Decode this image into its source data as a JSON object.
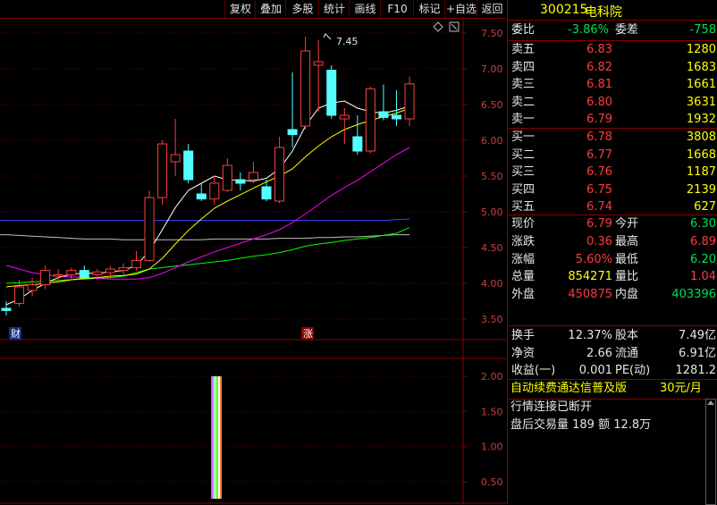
{
  "toolbar": {
    "buttons": [
      "复权",
      "叠加",
      "多股",
      "统计",
      "画线",
      "F10",
      "标记",
      "+自选",
      "返回"
    ]
  },
  "chart": {
    "price_ticks": [
      "7.50",
      "7.00",
      "6.50",
      "6.00",
      "5.50",
      "5.00",
      "4.50",
      "4.00",
      "3.50"
    ],
    "volume_ticks": [
      "2.00",
      "1.50",
      "1.00",
      "0.50"
    ],
    "high_label": "7.45",
    "marker_cai": "财",
    "marker_zhang": "涨"
  },
  "chart_data": {
    "type": "candlestick",
    "ylim": [
      3.3,
      7.7
    ],
    "candles": [
      {
        "o": 3.65,
        "h": 3.75,
        "l": 3.55,
        "c": 3.62
      },
      {
        "o": 3.72,
        "h": 4.05,
        "l": 3.68,
        "c": 3.95
      },
      {
        "o": 3.9,
        "h": 4.08,
        "l": 3.82,
        "c": 3.98
      },
      {
        "o": 3.98,
        "h": 4.25,
        "l": 3.92,
        "c": 4.18
      },
      {
        "o": 4.1,
        "h": 4.2,
        "l": 4.02,
        "c": 4.12
      },
      {
        "o": 4.12,
        "h": 4.22,
        "l": 4.05,
        "c": 4.18
      },
      {
        "o": 4.18,
        "h": 4.25,
        "l": 4.1,
        "c": 4.08
      },
      {
        "o": 4.12,
        "h": 4.2,
        "l": 4.05,
        "c": 4.16
      },
      {
        "o": 4.15,
        "h": 4.24,
        "l": 4.1,
        "c": 4.2
      },
      {
        "o": 4.18,
        "h": 4.28,
        "l": 4.12,
        "c": 4.22
      },
      {
        "o": 4.22,
        "h": 4.45,
        "l": 4.18,
        "c": 4.32
      },
      {
        "o": 4.32,
        "h": 5.3,
        "l": 4.3,
        "c": 5.2
      },
      {
        "o": 5.2,
        "h": 6.0,
        "l": 5.1,
        "c": 5.95
      },
      {
        "o": 5.7,
        "h": 6.3,
        "l": 5.5,
        "c": 5.8
      },
      {
        "o": 5.85,
        "h": 5.95,
        "l": 5.4,
        "c": 5.45
      },
      {
        "o": 5.25,
        "h": 5.4,
        "l": 5.15,
        "c": 5.18
      },
      {
        "o": 5.18,
        "h": 5.5,
        "l": 5.1,
        "c": 5.4
      },
      {
        "o": 5.3,
        "h": 5.75,
        "l": 5.28,
        "c": 5.65
      },
      {
        "o": 5.45,
        "h": 5.55,
        "l": 5.3,
        "c": 5.4
      },
      {
        "o": 5.45,
        "h": 5.7,
        "l": 5.4,
        "c": 5.55
      },
      {
        "o": 5.35,
        "h": 5.45,
        "l": 5.15,
        "c": 5.18
      },
      {
        "o": 5.15,
        "h": 6.05,
        "l": 5.12,
        "c": 5.9
      },
      {
        "o": 6.15,
        "h": 6.95,
        "l": 5.9,
        "c": 6.08
      },
      {
        "o": 6.2,
        "h": 7.45,
        "l": 6.15,
        "c": 7.25
      },
      {
        "o": 7.05,
        "h": 7.4,
        "l": 6.4,
        "c": 7.1
      },
      {
        "o": 6.98,
        "h": 7.05,
        "l": 6.3,
        "c": 6.35
      },
      {
        "o": 6.3,
        "h": 6.45,
        "l": 5.95,
        "c": 6.35
      },
      {
        "o": 6.05,
        "h": 6.35,
        "l": 5.8,
        "c": 5.85
      },
      {
        "o": 5.85,
        "h": 6.75,
        "l": 5.82,
        "c": 6.72
      },
      {
        "o": 6.4,
        "h": 6.78,
        "l": 6.28,
        "c": 6.32
      },
      {
        "o": 6.35,
        "h": 6.7,
        "l": 6.2,
        "c": 6.3
      },
      {
        "o": 6.3,
        "h": 6.89,
        "l": 6.2,
        "c": 6.79
      }
    ],
    "ma5": [
      3.7,
      3.78,
      3.9,
      4.0,
      4.08,
      4.13,
      4.14,
      4.14,
      4.16,
      4.18,
      4.25,
      4.45,
      4.75,
      5.06,
      5.3,
      5.4,
      5.5,
      5.45,
      5.44,
      5.43,
      5.47,
      5.6,
      5.85,
      6.2,
      6.45,
      6.52,
      6.55,
      6.45,
      6.4,
      6.38,
      6.42,
      6.48
    ],
    "ma10": [
      3.95,
      3.97,
      3.98,
      4.0,
      4.02,
      4.05,
      4.07,
      4.08,
      4.1,
      4.11,
      4.13,
      4.2,
      4.35,
      4.55,
      4.74,
      4.9,
      5.05,
      5.15,
      5.24,
      5.33,
      5.42,
      5.5,
      5.6,
      5.77,
      5.92,
      6.05,
      6.15,
      6.22,
      6.28,
      6.33,
      6.38,
      6.45
    ],
    "ma20": [
      4.25,
      4.2,
      4.15,
      4.12,
      4.1,
      4.09,
      4.08,
      4.07,
      4.06,
      4.06,
      4.06,
      4.08,
      4.14,
      4.22,
      4.3,
      4.37,
      4.44,
      4.5,
      4.56,
      4.62,
      4.68,
      4.75,
      4.85,
      4.97,
      5.1,
      5.23,
      5.34,
      5.44,
      5.56,
      5.68,
      5.8,
      5.9
    ],
    "ma30": [
      4.0,
      4.01,
      4.02,
      4.03,
      4.04,
      4.05,
      4.06,
      4.07,
      4.08,
      4.1,
      4.15,
      4.2,
      4.22,
      4.24,
      4.26,
      4.28,
      4.3,
      4.32,
      4.35,
      4.38,
      4.4,
      4.43,
      4.47,
      4.52,
      4.55,
      4.57,
      4.6,
      4.62,
      4.64,
      4.67,
      4.7,
      4.78
    ],
    "ma60": [
      4.88,
      4.88,
      4.88,
      4.88,
      4.88,
      4.88,
      4.88,
      4.88,
      4.88,
      4.88,
      4.88,
      4.88,
      4.88,
      4.88,
      4.88,
      4.88,
      4.88,
      4.88,
      4.88,
      4.88,
      4.88,
      4.88,
      4.88,
      4.88,
      4.88,
      4.88,
      4.88,
      4.88,
      4.88,
      4.88,
      4.89,
      4.9
    ],
    "ma120": [
      4.68,
      4.67,
      4.66,
      4.65,
      4.64,
      4.63,
      4.62,
      4.62,
      4.62,
      4.61,
      4.61,
      4.61,
      4.61,
      4.61,
      4.61,
      4.61,
      4.62,
      4.62,
      4.62,
      4.62,
      4.62,
      4.63,
      4.63,
      4.63,
      4.64,
      4.64,
      4.65,
      4.65,
      4.66,
      4.67,
      4.68,
      4.68
    ],
    "volume": {
      "ylim": [
        0,
        2.2
      ],
      "bar_index": 10,
      "value": 2.0
    },
    "colors": {
      "up": "#ff3c3c",
      "down": "#54ffff",
      "ma5": "#ffffff",
      "ma10": "#ffff00",
      "ma20": "#ff00ff",
      "ma30": "#00ff00",
      "ma60": "#4040ff",
      "ma120": "#c0c0c0"
    }
  },
  "quote": {
    "code": "300215",
    "name": "电科院",
    "webi_label": "委比",
    "webi_value": "-3.86%",
    "weicha_label": "委差",
    "weicha_value": "-758",
    "asks": [
      {
        "label": "卖五",
        "price": "6.83",
        "vol": "1280"
      },
      {
        "label": "卖四",
        "price": "6.82",
        "vol": "1683"
      },
      {
        "label": "卖三",
        "price": "6.81",
        "vol": "1661"
      },
      {
        "label": "卖二",
        "price": "6.80",
        "vol": "3631"
      },
      {
        "label": "卖一",
        "price": "6.79",
        "vol": "1932"
      }
    ],
    "bids": [
      {
        "label": "买一",
        "price": "6.78",
        "vol": "3808"
      },
      {
        "label": "买二",
        "price": "6.77",
        "vol": "1668"
      },
      {
        "label": "买三",
        "price": "6.76",
        "vol": "1187"
      },
      {
        "label": "买四",
        "price": "6.75",
        "vol": "2139"
      },
      {
        "label": "买五",
        "price": "6.74",
        "vol": "627"
      }
    ],
    "stats1": [
      {
        "l1": "现价",
        "v1": "6.79",
        "c1": "red",
        "l2": "今开",
        "v2": "6.30",
        "c2": "green"
      },
      {
        "l1": "涨跌",
        "v1": "0.36",
        "c1": "red",
        "l2": "最高",
        "v2": "6.89",
        "c2": "red"
      },
      {
        "l1": "涨幅",
        "v1": "5.60%",
        "c1": "red",
        "l2": "最低",
        "v2": "6.20",
        "c2": "green"
      },
      {
        "l1": "总量",
        "v1": "854271",
        "c1": "yellow",
        "l2": "量比",
        "v2": "1.04",
        "c2": "red"
      },
      {
        "l1": "外盘",
        "v1": "450875",
        "c1": "red",
        "l2": "内盘",
        "v2": "403396",
        "c2": "green"
      }
    ],
    "stats2": [
      {
        "l1": "换手",
        "v1": "12.37%",
        "l2": "股本",
        "v2": "7.49亿"
      },
      {
        "l1": "净资",
        "v1": "2.66",
        "l2": "流通",
        "v2": "6.91亿"
      },
      {
        "l1": "收益(一)",
        "v1": "0.001",
        "l2": "PE(动)",
        "v2": "1281.2"
      }
    ],
    "ad_text": "自动续费通达信普及版",
    "ad_price": "30元/月",
    "status_text": "行情连接已断开",
    "after_hours": "盘后交易量 189 额 12.8万"
  }
}
